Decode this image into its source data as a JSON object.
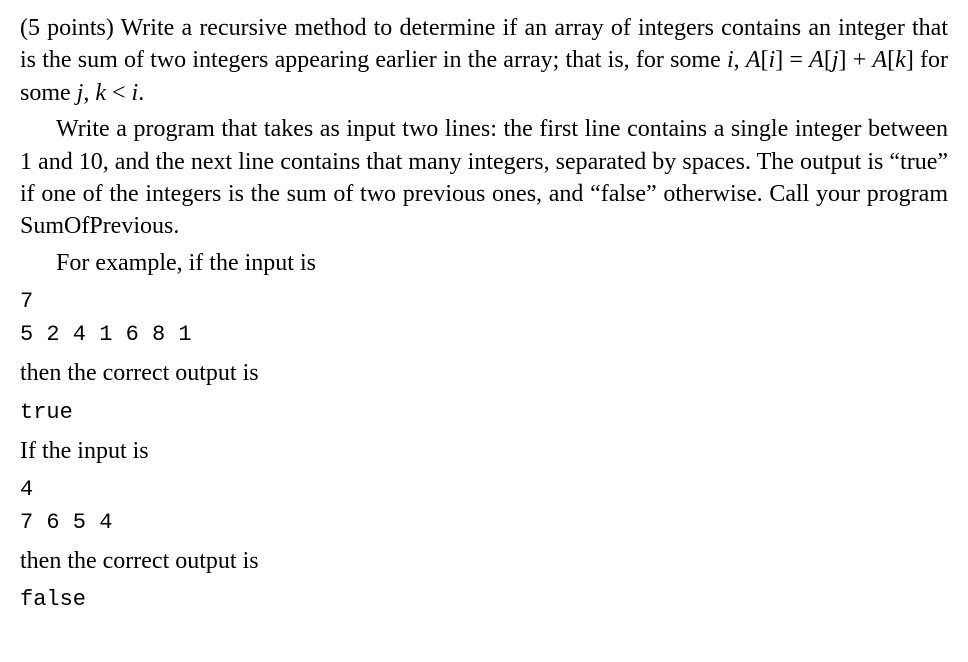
{
  "p1_a": "(5 points) Write a recursive method to determine if an array of integers contains an integer that is the sum of two integers appearing earlier in the array; that is, for some ",
  "m_i1": "i",
  "p1_b": ", ",
  "m_Ai": "A",
  "m_br1_open": "[",
  "m_i2": "i",
  "m_br1_close": "]",
  "m_eq": " = ",
  "m_Aj": "A",
  "m_br2_open": "[",
  "m_j1": "j",
  "m_br2_close": "]",
  "m_plus": " + ",
  "m_Ak": "A",
  "m_br3_open": "[",
  "m_k1": "k",
  "m_br3_close": "]",
  "p1_c": " for some ",
  "m_j2": "j",
  "m_comma": ", ",
  "m_k2": "k",
  "m_lt": " < ",
  "m_i3": "i",
  "p1_d": ".",
  "p2": "Write a program that takes as input two lines: the first line contains a single integer between 1 and 10, and the next line contains that many integers, separated by spaces. The output is “true” if one of the integers is the sum of two previous ones, and “false” otherwise. Call your program SumOfPrevious.",
  "p3": "For example, if the input is",
  "ex1_l1": "7",
  "ex1_l2": "5 2 4 1 6 8 1",
  "p4": "then the correct output is",
  "ex1_out": "true",
  "p5": "If the input is",
  "ex2_l1": "4",
  "ex2_l2": "7 6 5 4",
  "p6": "then the correct output is",
  "ex2_out": "false"
}
